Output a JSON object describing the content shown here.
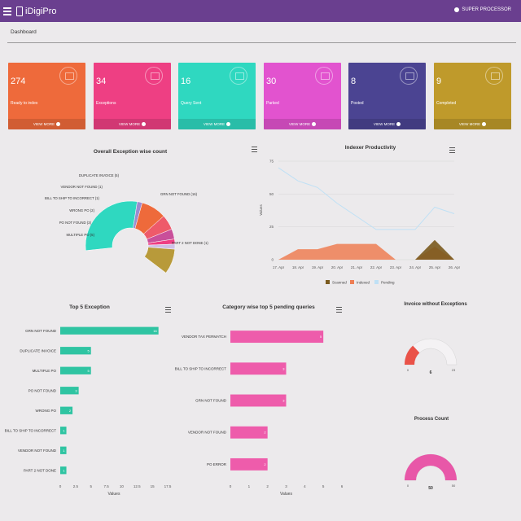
{
  "header": {
    "app_name": "iDigiPro",
    "user": "SUPER PROCESSOR",
    "icons": [
      "menu-icon",
      "logo-icon",
      "user-icon"
    ]
  },
  "breadcrumb": "Dashboard",
  "cards": [
    {
      "value": "274",
      "label": "Ready to index",
      "link": "VIEW MORE",
      "color": "#ee6a3b"
    },
    {
      "value": "34",
      "label": "Exceptions",
      "link": "VIEW MORE",
      "color": "#ee3f83"
    },
    {
      "value": "16",
      "label": "Query Sent",
      "link": "VIEW MORE",
      "color": "#2fd8c0"
    },
    {
      "value": "30",
      "label": "Parked",
      "link": "VIEW MORE",
      "color": "#e253cf"
    },
    {
      "value": "8",
      "label": "Posted",
      "link": "VIEW MORE",
      "color": "#4b4492"
    },
    {
      "value": "9",
      "label": "Completed",
      "link": "VIEW MORE",
      "color": "#bf9a2b"
    }
  ],
  "chart_data": [
    {
      "type": "pie",
      "title": "Overall Exception wise count",
      "categories": [
        "GRN NOT FOUND",
        "PART 2 NOT DONE",
        "MULTIPLE PO",
        "PO NOT FOUND",
        "WRONG PO",
        "BILL TO SHIP TO INCORRECT",
        "VENDOR NOT FOUND",
        "DUPLICATE INVOICE"
      ],
      "values": [
        16,
        1,
        5,
        3,
        2,
        1,
        1,
        5
      ],
      "labels": [
        "GRN NOT FOUND (16)",
        "PART 2 NOT DONE (1)",
        "MULTIPLE PO (5)",
        "PO NOT FOUND (3)",
        "WRONG PO (2)",
        "BILL TO SHIP TO INCORRECT (1)",
        "VENDOR NOT FOUND (1)",
        "DUPLICATE INVOICE (5)"
      ],
      "colors": [
        "#2fd8c0",
        "#9c8bd0",
        "#ee6a3b",
        "#ee5a6a",
        "#c94f9a",
        "#ee3f83",
        "#cfc0e6",
        "#b89a3a"
      ]
    },
    {
      "type": "area",
      "title": "Indexer Productivity",
      "xlabel": "",
      "ylabel": "Values",
      "categories": [
        "17. Apr",
        "18. Apr",
        "19. Apr",
        "20. Apr",
        "21. Apr",
        "22. Apr",
        "23. Apr",
        "24. Apr",
        "25. Apr",
        "26. Apr"
      ],
      "yticks": [
        0,
        25,
        50,
        75
      ],
      "ylim": [
        0,
        75
      ],
      "series": [
        {
          "name": "Scanned",
          "values": [
            0,
            0,
            0,
            0,
            0,
            0,
            0,
            0,
            15,
            0
          ],
          "color": "#7a5a1e"
        },
        {
          "name": "Indexed",
          "values": [
            0,
            8,
            8,
            12,
            12,
            12,
            0,
            0,
            10,
            0
          ],
          "color": "#ee7e54"
        },
        {
          "name": "Pending",
          "values": [
            70,
            60,
            55,
            43,
            33,
            23,
            23,
            23,
            40,
            35
          ],
          "color": "#bfe0f5"
        }
      ],
      "legend": "bottom"
    },
    {
      "type": "bar",
      "title": "Top 5 Exception",
      "xlabel": "Values",
      "orientation": "horizontal",
      "categories": [
        "GRN NOT FOUND",
        "DUPLICATE INVOICE",
        "MULTIPLE PO",
        "PO NOT FOUND",
        "WRONG PO",
        "BILL TO SHIP TO INCORRECT",
        "VENDOR NOT FOUND",
        "PART 2 NOT DONE"
      ],
      "values": [
        16,
        5,
        5,
        3,
        2,
        1,
        1,
        1
      ],
      "xticks": [
        "0",
        "2.5",
        "5",
        "7.5",
        "10",
        "12.5",
        "15",
        "17.5"
      ],
      "xlim": [
        0,
        17.5
      ],
      "color": "#2fc4a2"
    },
    {
      "type": "bar",
      "title": "Category wise top 5 pending queries",
      "xlabel": "Values",
      "orientation": "horizontal",
      "categories": [
        "VENDOR TAX PERMATCH",
        "BILL TO SHIP TO INCORRECT",
        "GRN NOT FOUND",
        "VENDOR NOT FOUND",
        "PO ERROR"
      ],
      "values": [
        5,
        3,
        3,
        2,
        2
      ],
      "xticks": [
        "0",
        "1",
        "2",
        "3",
        "4",
        "5",
        "6"
      ],
      "xlim": [
        0,
        6
      ],
      "color": "#ee5cab"
    },
    {
      "type": "gauge",
      "title": "Invoice without Exceptions",
      "value": 6,
      "min": 0,
      "max": 23,
      "color": "#ea5248"
    },
    {
      "type": "gauge",
      "title": "Process Count",
      "value": 50,
      "min": 0,
      "max": 50,
      "color": "#e857a8"
    }
  ]
}
